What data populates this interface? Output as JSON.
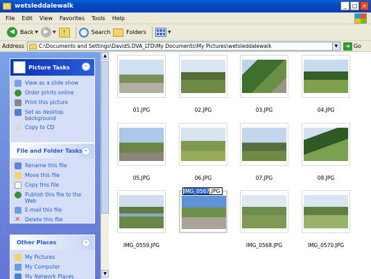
{
  "window": {
    "title": "wetsleddalewalk"
  },
  "menu": [
    "File",
    "Edit",
    "View",
    "Favorites",
    "Tools",
    "Help"
  ],
  "toolbar": {
    "back_label": "Back",
    "search_label": "Search",
    "folders_label": "Folders"
  },
  "address": {
    "label": "Address",
    "value": "C:\\Documents and Settings\\DavidS.DVA_LTD\\My Documents\\My Pictures\\wetsleddalewalk",
    "go_label": "Go"
  },
  "picture_tasks": {
    "title": "Picture Tasks",
    "items": [
      "View as a slide show",
      "Order prints online",
      "Print this picture",
      "Set as desktop background",
      "Copy to CD"
    ]
  },
  "file_tasks": {
    "title": "File and Folder Tasks",
    "items": [
      "Rename this file",
      "Move this file",
      "Copy this file",
      "Publish this file to the Web",
      "E-mail this file",
      "Delete this file"
    ]
  },
  "other_places": {
    "title": "Other Places",
    "items": [
      "My Pictures",
      "My Computer",
      "My Network Places"
    ]
  },
  "files": [
    {
      "name": "01.JPG"
    },
    {
      "name": "02.JPG"
    },
    {
      "name": "03.JPG"
    },
    {
      "name": "04.JPG"
    },
    {
      "name": "05.JPG"
    },
    {
      "name": "06.JPG"
    },
    {
      "name": "07.JPG"
    },
    {
      "name": "08.JPG"
    },
    {
      "name": "IMG_0559.JPG"
    },
    {
      "name": "IMG_0567.JPG"
    },
    {
      "name": "IMG_0568.JPG"
    },
    {
      "name": "IMG_0570.JPG"
    }
  ],
  "rename": {
    "selected": "IMG_0567",
    "suffix": ".JPG"
  },
  "colors": {
    "titlebar": "#0a5fd8",
    "taskpane": "#7ba2e7",
    "link": "#215dc6",
    "selection": "#316ac5"
  }
}
